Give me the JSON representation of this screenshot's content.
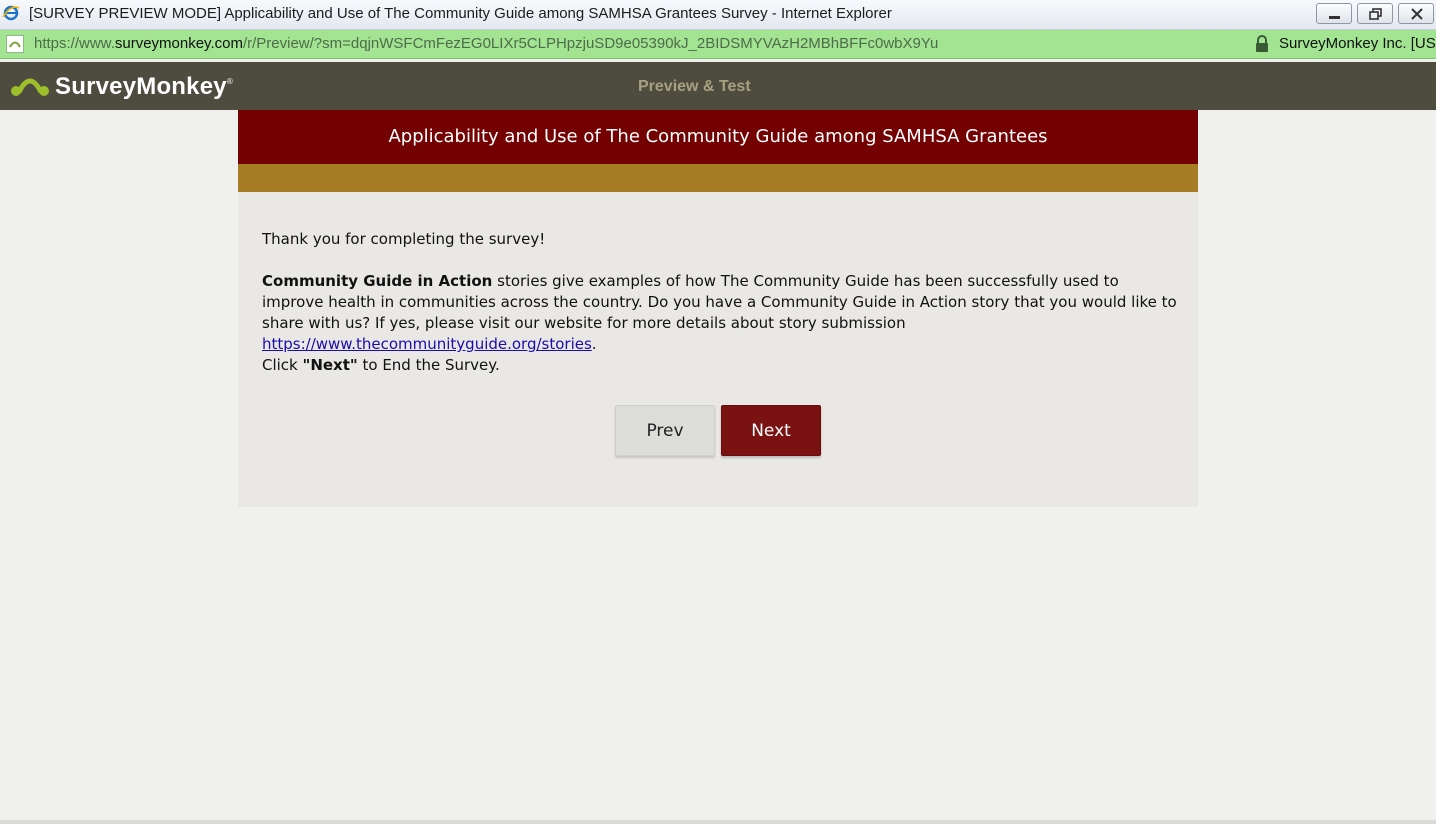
{
  "window": {
    "title": "[SURVEY PREVIEW MODE] Applicability and Use of The Community Guide among SAMHSA Grantees Survey - Internet Explorer"
  },
  "address_bar": {
    "url_scheme": "https://www.",
    "url_host": "surveymonkey.com",
    "url_path": "/r/Preview/?sm=dqjnWSFCmFezEG0LIXr5CLPHpzjuSD9e05390kJ_2BIDSMYVAzH2MBhBFFc0wbX9Yu",
    "certificate_owner": "SurveyMonkey Inc. [US]"
  },
  "header": {
    "logo_text": "SurveyMonkey",
    "logo_mark": "®",
    "mode_label": "Preview & Test"
  },
  "survey": {
    "title": "Applicability and Use of The Community Guide among SAMHSA Grantees",
    "thank_you": "Thank you for completing the survey!",
    "cg_bold": "Community Guide in Action",
    "cg_text": " stories give examples of how The Community Guide has been successfully used to improve health in communities across the country. Do you have a Community Guide in Action story that you would like to share with us? If yes, please visit our website for more details about story submission ",
    "link_text": "https://www.thecommunityguide.org/stories",
    "after_link": ".",
    "click_prefix": "Click ",
    "click_bold": "\"Next\"",
    "click_suffix": " to End the Survey.",
    "prev_label": "Prev",
    "next_label": "Next"
  },
  "colors": {
    "title_bg": "#740101",
    "gold_bar": "#a67c25",
    "next_button": "#7a1212",
    "header_bg": "#4e4b3f",
    "address_bar_bg": "#a3e493"
  }
}
